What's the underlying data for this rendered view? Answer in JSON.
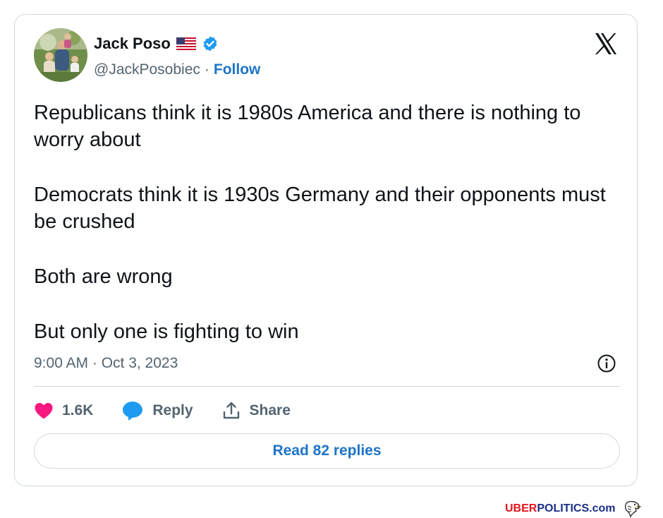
{
  "tweet": {
    "author": {
      "name": "Jack Poso",
      "handle": "@JackPosobiec",
      "separator": "·",
      "follow_label": "Follow",
      "flag_icon": "us-flag-icon",
      "verified_icon": "verified-badge-icon"
    },
    "platform_icon": "x-logo-icon",
    "body": {
      "paragraph_1": "Republicans think it is 1980s America and there is nothing to worry about",
      "paragraph_2": "Democrats think it is 1930s Germany and their opponents must be crushed",
      "paragraph_3": "Both are wrong",
      "paragraph_4": "But only one is fighting to win"
    },
    "timestamp": "9:00 AM · Oct 3, 2023",
    "actions": {
      "likes_count": "1.6K",
      "reply_label": "Reply",
      "share_label": "Share"
    },
    "read_replies_label": "Read 82 replies"
  },
  "watermark": {
    "brand_red": "UBER",
    "brand_blue": "POLITICS",
    "brand_suffix": ".com",
    "logo_icon": "eagle-logo-icon"
  },
  "colors": {
    "link_blue": "#1d74c8",
    "heart_pink": "#f91880",
    "bubble_blue": "#1d9bf0",
    "secondary_text": "#536471",
    "border": "#cfd9de",
    "watermark_red": "#e3131b",
    "watermark_blue": "#1b2f87"
  }
}
